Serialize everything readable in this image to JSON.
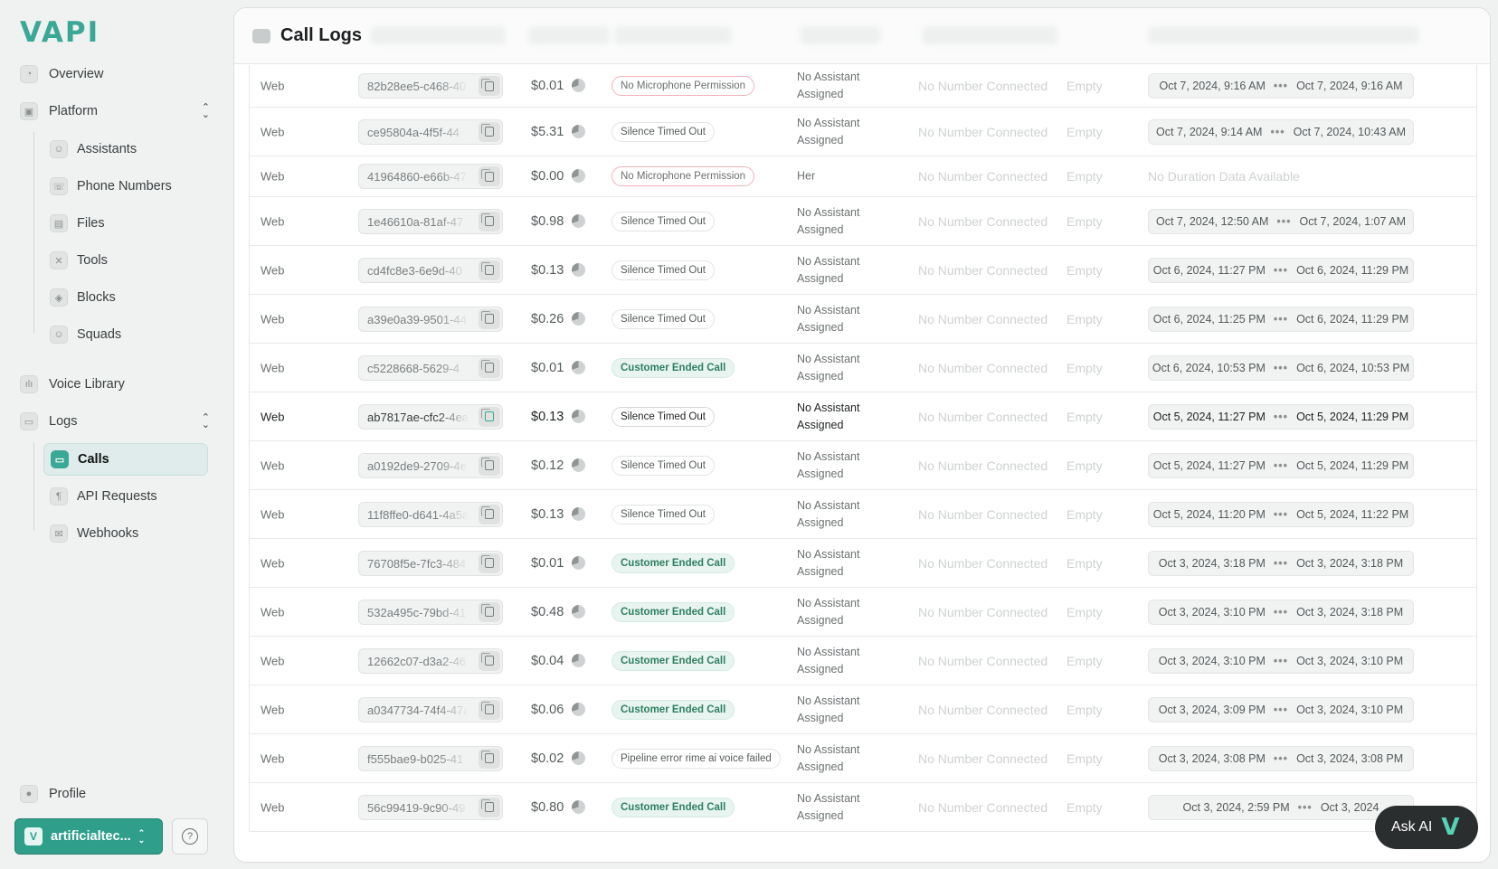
{
  "app": {
    "logo": "VAPI"
  },
  "sidebar": {
    "overview": "Overview",
    "platform": {
      "label": "Platform",
      "items": [
        "Assistants",
        "Phone Numbers",
        "Files",
        "Tools",
        "Blocks",
        "Squads"
      ]
    },
    "voice_library": "Voice Library",
    "logs": {
      "label": "Logs",
      "items": [
        "Calls",
        "API Requests",
        "Webhooks"
      ],
      "active": "Calls"
    },
    "profile": "Profile",
    "org": {
      "badge": "V",
      "name": "artificialtec..."
    },
    "help": "?"
  },
  "page": {
    "title": "Call Logs"
  },
  "rows": [
    {
      "type": "Web",
      "id": "82b28ee5-c468-40",
      "cost": "$0.01",
      "reason": "No Microphone Permission",
      "reason_style": "red",
      "assistant_line1": "No Assistant",
      "assistant_line2": "Assigned",
      "phone": "No Number Connected",
      "customer": "Empty",
      "start": "Oct 7, 2024, 9:16 AM",
      "end": "Oct 7, 2024, 9:16 AM"
    },
    {
      "type": "Web",
      "id": "ce95804a-4f5f-44",
      "cost": "$5.31",
      "reason": "Silence Timed Out",
      "reason_style": "gray",
      "assistant_line1": "No Assistant",
      "assistant_line2": "Assigned",
      "phone": "No Number Connected",
      "customer": "Empty",
      "start": "Oct 7, 2024, 9:14 AM",
      "end": "Oct 7, 2024, 10:43 AM"
    },
    {
      "type": "Web",
      "id": "41964860-e66b-47",
      "cost": "$0.00",
      "reason": "No Microphone Permission",
      "reason_style": "red",
      "assistant_line1": "Her",
      "assistant_line2": "",
      "phone": "No Number Connected",
      "customer": "Empty",
      "no_duration": "No Duration Data Available"
    },
    {
      "type": "Web",
      "id": "1e46610a-81af-47",
      "cost": "$0.98",
      "reason": "Silence Timed Out",
      "reason_style": "gray",
      "assistant_line1": "No Assistant",
      "assistant_line2": "Assigned",
      "phone": "No Number Connected",
      "customer": "Empty",
      "start": "Oct 7, 2024, 12:50 AM",
      "end": "Oct 7, 2024, 1:07 AM"
    },
    {
      "type": "Web",
      "id": "cd4fc8e3-6e9d-40",
      "cost": "$0.13",
      "reason": "Silence Timed Out",
      "reason_style": "gray",
      "assistant_line1": "No Assistant",
      "assistant_line2": "Assigned",
      "phone": "No Number Connected",
      "customer": "Empty",
      "start": "Oct 6, 2024, 11:27 PM",
      "end": "Oct 6, 2024, 11:29 PM"
    },
    {
      "type": "Web",
      "id": "a39e0a39-9501-44",
      "cost": "$0.26",
      "reason": "Silence Timed Out",
      "reason_style": "gray",
      "assistant_line1": "No Assistant",
      "assistant_line2": "Assigned",
      "phone": "No Number Connected",
      "customer": "Empty",
      "start": "Oct 6, 2024, 11:25 PM",
      "end": "Oct 6, 2024, 11:29 PM"
    },
    {
      "type": "Web",
      "id": "c5228668-5629-4",
      "cost": "$0.01",
      "reason": "Customer Ended Call",
      "reason_style": "green",
      "assistant_line1": "No Assistant",
      "assistant_line2": "Assigned",
      "phone": "No Number Connected",
      "customer": "Empty",
      "start": "Oct 6, 2024, 10:53 PM",
      "end": "Oct 6, 2024, 10:53 PM"
    },
    {
      "type": "Web",
      "id": "ab7817ae-cfc2-4ea",
      "cost": "$0.13",
      "reason": "Silence Timed Out",
      "reason_style": "gray",
      "assistant_line1": "No Assistant",
      "assistant_line2": "Assigned",
      "phone": "No Number Connected",
      "customer": "Empty",
      "start": "Oct 5, 2024, 11:27 PM",
      "end": "Oct 5, 2024, 11:29 PM",
      "highlight": true
    },
    {
      "type": "Web",
      "id": "a0192de9-2709-4e",
      "cost": "$0.12",
      "reason": "Silence Timed Out",
      "reason_style": "gray",
      "assistant_line1": "No Assistant",
      "assistant_line2": "Assigned",
      "phone": "No Number Connected",
      "customer": "Empty",
      "start": "Oct 5, 2024, 11:27 PM",
      "end": "Oct 5, 2024, 11:29 PM"
    },
    {
      "type": "Web",
      "id": "11f8ffe0-d641-4a5a",
      "cost": "$0.13",
      "reason": "Silence Timed Out",
      "reason_style": "gray",
      "assistant_line1": "No Assistant",
      "assistant_line2": "Assigned",
      "phone": "No Number Connected",
      "customer": "Empty",
      "start": "Oct 5, 2024, 11:20 PM",
      "end": "Oct 5, 2024, 11:22 PM"
    },
    {
      "type": "Web",
      "id": "76708f5e-7fc3-484",
      "cost": "$0.01",
      "reason": "Customer Ended Call",
      "reason_style": "green",
      "assistant_line1": "No Assistant",
      "assistant_line2": "Assigned",
      "phone": "No Number Connected",
      "customer": "Empty",
      "start": "Oct 3, 2024, 3:18 PM",
      "end": "Oct 3, 2024, 3:18 PM"
    },
    {
      "type": "Web",
      "id": "532a495c-79bd-41",
      "cost": "$0.48",
      "reason": "Customer Ended Call",
      "reason_style": "green",
      "assistant_line1": "No Assistant",
      "assistant_line2": "Assigned",
      "phone": "No Number Connected",
      "customer": "Empty",
      "start": "Oct 3, 2024, 3:10 PM",
      "end": "Oct 3, 2024, 3:18 PM"
    },
    {
      "type": "Web",
      "id": "12662c07-d3a2-46",
      "cost": "$0.04",
      "reason": "Customer Ended Call",
      "reason_style": "green",
      "assistant_line1": "No Assistant",
      "assistant_line2": "Assigned",
      "phone": "No Number Connected",
      "customer": "Empty",
      "start": "Oct 3, 2024, 3:10 PM",
      "end": "Oct 3, 2024, 3:10 PM"
    },
    {
      "type": "Web",
      "id": "a0347734-74f4-47a",
      "cost": "$0.06",
      "reason": "Customer Ended Call",
      "reason_style": "green",
      "assistant_line1": "No Assistant",
      "assistant_line2": "Assigned",
      "phone": "No Number Connected",
      "customer": "Empty",
      "start": "Oct 3, 2024, 3:09 PM",
      "end": "Oct 3, 2024, 3:10 PM"
    },
    {
      "type": "Web",
      "id": "f555bae9-b025-41",
      "cost": "$0.02",
      "reason": "Pipeline error rime ai voice failed",
      "reason_style": "gray",
      "assistant_line1": "No Assistant",
      "assistant_line2": "Assigned",
      "phone": "No Number Connected",
      "customer": "Empty",
      "start": "Oct 3, 2024, 3:08 PM",
      "end": "Oct 3, 2024, 3:08 PM"
    },
    {
      "type": "Web",
      "id": "56c99419-9c90-49",
      "cost": "$0.80",
      "reason": "Customer Ended Call",
      "reason_style": "green",
      "assistant_line1": "No Assistant",
      "assistant_line2": "Assigned",
      "phone": "No Number Connected",
      "customer": "Empty",
      "start": "Oct 3, 2024, 2:59 PM",
      "end": "Oct 3, 2024"
    }
  ],
  "ask_ai": {
    "label": "Ask AI",
    "logo": "V"
  }
}
